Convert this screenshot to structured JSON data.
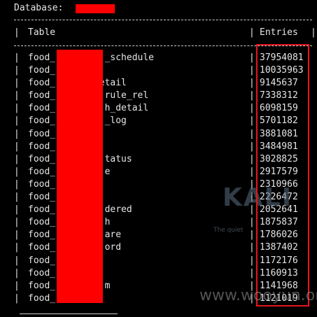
{
  "header": {
    "database_label": "Database:",
    "col_table": "Table",
    "col_entries": "Entries",
    "pipe": "|"
  },
  "rows": [
    {
      "table": "food_         _schedule",
      "entries": "37954081"
    },
    {
      "table": "food_",
      "entries": "10035963"
    },
    {
      "table": "food_        etail",
      "entries": "9145637"
    },
    {
      "table": "food_         rule_rel",
      "entries": "7338312"
    },
    {
      "table": "food_         h_detail",
      "entries": "6098159"
    },
    {
      "table": "food_         _log",
      "entries": "5701182"
    },
    {
      "table": "food_",
      "entries": "3881081"
    },
    {
      "table": "food_",
      "entries": "3484981"
    },
    {
      "table": "food_         tatus",
      "entries": "3028825"
    },
    {
      "table": "food_         e",
      "entries": "2917579"
    },
    {
      "table": "food_",
      "entries": "2310966"
    },
    {
      "table": "food_",
      "entries": "2226472"
    },
    {
      "table": "food_         dered",
      "entries": "2052641"
    },
    {
      "table": "food_         h",
      "entries": "1875837"
    },
    {
      "table": "food_         are",
      "entries": "1786026"
    },
    {
      "table": "food_         ord",
      "entries": "1387402"
    },
    {
      "table": "food_",
      "entries": "1172176"
    },
    {
      "table": "food_",
      "entries": "1160913"
    },
    {
      "table": "food_         m",
      "entries": "1141968"
    },
    {
      "table": "food_",
      "entries": "1121019"
    }
  ],
  "watermarks": {
    "logo_text": "KALI",
    "tagline": "The quiet",
    "site": "www.wooyun.org"
  },
  "colors": {
    "background": "#000000",
    "text": "#e6e6e6",
    "redaction": "#ff0000",
    "highlight_box": "#e8141c"
  }
}
